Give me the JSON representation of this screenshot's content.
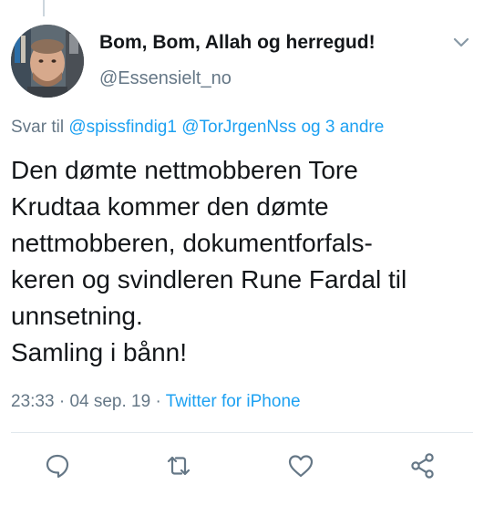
{
  "tweet": {
    "display_name": "Bom, Bom, Allah og herregud!",
    "handle": "@Essensielt_no",
    "reply": {
      "prefix": "Svar til",
      "mentions": [
        "@spissfindig1",
        "@TorJrgenNss"
      ],
      "and_text": "og",
      "others": "3 andre"
    },
    "text_lines": [
      "Den dømte nettmobberen Tore",
      "Krudtaa kommer den dømte",
      "nettmobberen, dokumentforfals-",
      "keren og svindleren Rune Fardal til",
      "unnsetning.",
      "Samling i bånn!"
    ],
    "time": "23:33",
    "date": "04 sep. 19",
    "separator": "·",
    "source": "Twitter for iPhone"
  },
  "icons": {
    "menu": "chevron-down-icon",
    "reply": "reply-icon",
    "retweet": "retweet-icon",
    "like": "heart-icon",
    "share": "share-icon"
  },
  "colors": {
    "accent": "#1da1f2",
    "secondary_text": "#657786",
    "primary_text": "#14171a",
    "divider": "#e1e8ed"
  }
}
